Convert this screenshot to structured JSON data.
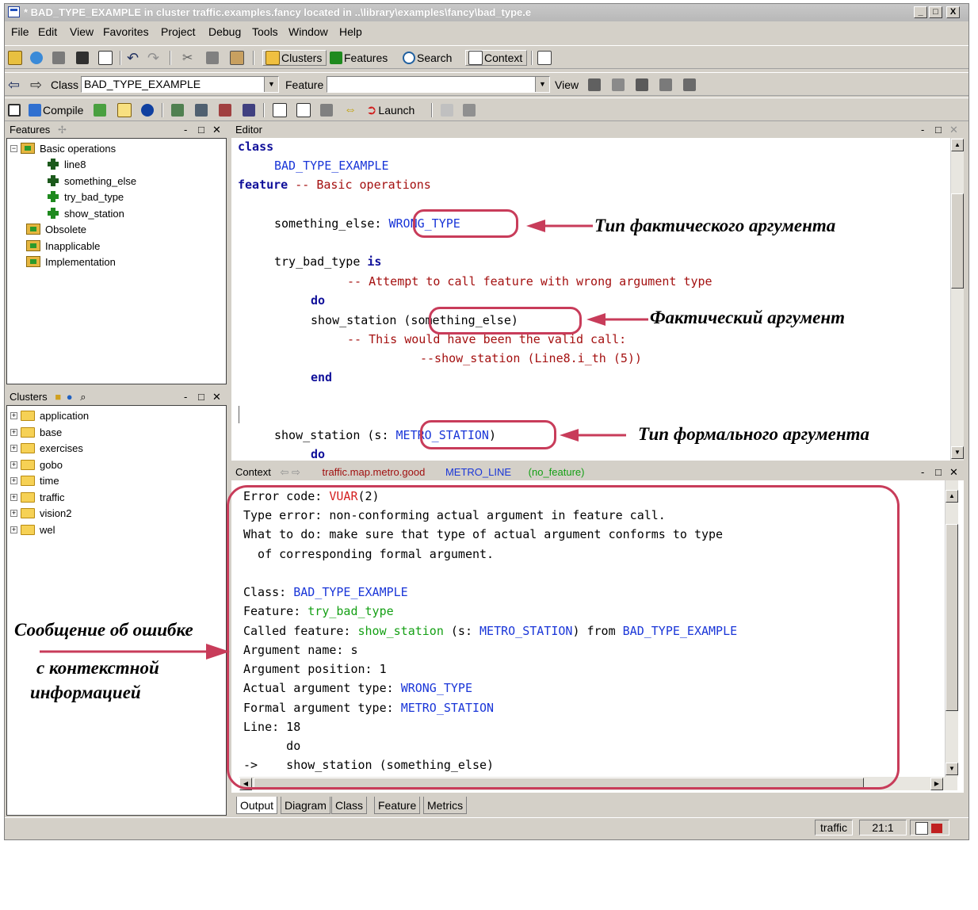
{
  "window": {
    "title": "* BAD_TYPE_EXAMPLE  in cluster traffic.examples.fancy   located in ..\\library\\examples\\fancy\\bad_type.e",
    "minimize": "_",
    "maximize": "□",
    "close": "X"
  },
  "menu": [
    "File",
    "Edit",
    "View",
    "Favorites",
    "Project",
    "Debug",
    "Tools",
    "Window",
    "Help"
  ],
  "toolbar1": {
    "clusters": "Clusters",
    "features": "Features",
    "search": "Search",
    "context": "Context"
  },
  "toolbar2": {
    "class_label": "Class",
    "class_value": "BAD_TYPE_EXAMPLE",
    "feature_label": "Feature",
    "feature_value": "",
    "view_label": "View"
  },
  "toolbar3": {
    "compile": "Compile",
    "launch": "Launch"
  },
  "features_panel": {
    "title": "Features",
    "items": [
      {
        "label": "Basic operations"
      },
      {
        "label": "line8"
      },
      {
        "label": "something_else"
      },
      {
        "label": "try_bad_type"
      },
      {
        "label": "show_station"
      },
      {
        "label": "Obsolete"
      },
      {
        "label": "Inapplicable"
      },
      {
        "label": "Implementation"
      }
    ]
  },
  "clusters_panel": {
    "title": "Clusters",
    "items": [
      {
        "label": "application"
      },
      {
        "label": "base"
      },
      {
        "label": "exercises"
      },
      {
        "label": "gobo"
      },
      {
        "label": "time"
      },
      {
        "label": "traffic"
      },
      {
        "label": "vision2"
      },
      {
        "label": "wel"
      }
    ]
  },
  "editor": {
    "title": "Editor",
    "code": {
      "l1_kw": "class",
      "l2_cls": "BAD_TYPE_EXAMPLE",
      "l3_kw": "feature",
      "l3_cmt": "-- Basic operations",
      "l4_name": "something_else:",
      "l4_type": "WRONG_TYPE",
      "l5_name": "try_bad_type",
      "l5_kw": "is",
      "l6_cmt": "-- Attempt to call feature with wrong argument type",
      "l7_kw": "do",
      "l8_call": "show_station",
      "l8_arg": "(something_else)",
      "l9_cmt": "-- This would have been the valid call:",
      "l10_cmt": "--show_station (Line8.i_th (5))",
      "l11_kw": "end",
      "l12_name": "show_station (s:",
      "l12_type": "METRO_STATION",
      "l12_close": ")",
      "l13_kw": "do"
    }
  },
  "context": {
    "title": "Context",
    "path": "traffic.map.metro.good",
    "class": "METRO_LINE",
    "feature": "(no_feature)",
    "output": {
      "error_label": "Error code: ",
      "error_code": "VUAR",
      "error_suffix": "(2)",
      "type_error": "Type error: non-conforming actual argument in feature call.",
      "what_to_do_1": "What to do: make sure that type of actual argument conforms to type",
      "what_to_do_2": "  of corresponding formal argument.",
      "class_label": "Class: ",
      "class_value": "BAD_TYPE_EXAMPLE",
      "feature_label": "Feature: ",
      "feature_value": "try_bad_type",
      "called_label": "Called feature: ",
      "called_feature": "show_station",
      "called_sig_open": " (s: ",
      "called_sig_type": "METRO_STATION",
      "called_sig_close": ") from ",
      "called_from": "BAD_TYPE_EXAMPLE",
      "arg_name": "Argument name: s",
      "arg_pos": "Argument position: 1",
      "actual_label": "Actual argument type: ",
      "actual_type": "WRONG_TYPE",
      "formal_label": "Formal argument type: ",
      "formal_type": "METRO_STATION",
      "line": "Line: 18",
      "do": "      do",
      "arrow_line": "->    show_station (something_else)"
    }
  },
  "tabs": [
    "Output",
    "Diagram",
    "Class",
    "Feature",
    "Metrics"
  ],
  "status": {
    "cluster": "traffic",
    "position": "21:1"
  },
  "annotations": {
    "actual_type": "Тип фактического аргумента",
    "actual_arg": "Фактический аргумент",
    "formal_type": "Тип формального аргумента",
    "error_msg_1": "Сообщение об ошибке",
    "error_msg_2": "с контекстной",
    "error_msg_3": "информацией"
  }
}
